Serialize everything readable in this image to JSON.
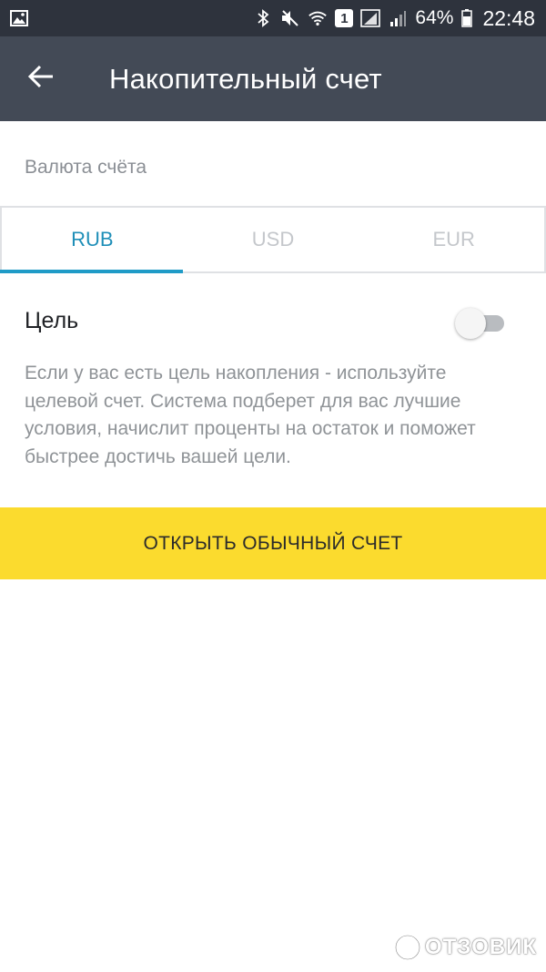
{
  "status_bar": {
    "battery_percent": "64%",
    "time": "22:48",
    "sim_badge": "1",
    "icons": [
      "image-icon",
      "bluetooth-icon",
      "mute-icon",
      "wifi-icon",
      "sim-badge-icon",
      "signal-1-icon",
      "signal-2-icon",
      "battery-icon"
    ]
  },
  "app_bar": {
    "title": "Накопительный счет",
    "back_icon": "arrow-left-icon"
  },
  "currency": {
    "label": "Валюта счёта",
    "tabs": [
      {
        "label": "RUB",
        "active": true
      },
      {
        "label": "USD",
        "active": false
      },
      {
        "label": "EUR",
        "active": false
      }
    ]
  },
  "goal": {
    "label": "Цель",
    "enabled": false,
    "description": "Если у вас есть цель накопления - используйте целевой счет. Система подберет для вас лучшие условия, начислит проценты на остаток и поможет быстрее достичь вашей цели."
  },
  "open_button": {
    "label": "ОТКРЫТЬ ОБЫЧНЫЙ СЧЕТ"
  },
  "watermark": {
    "text": "ОТЗОВИК"
  },
  "colors": {
    "status_bar": "#2e333d",
    "app_bar": "#434a56",
    "accent": "#1f8fb8",
    "button": "#fbdb2e"
  }
}
